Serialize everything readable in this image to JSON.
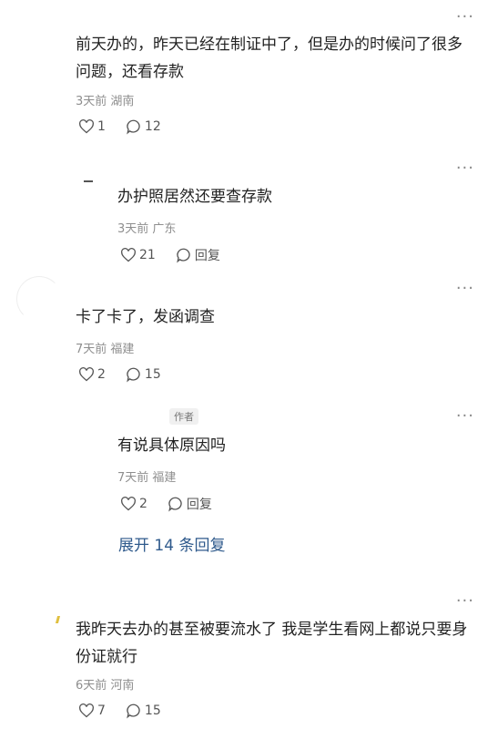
{
  "comments": [
    {
      "text": "前天办的，昨天已经在制证中了，但是办的时候问了很多问题，还看存款",
      "time": "3天前",
      "region": "湖南",
      "likes": "1",
      "replies": "12"
    },
    {
      "text": "办护照居然还要查存款",
      "time": "3天前",
      "region": "广东",
      "likes": "21",
      "reply_label": "回复"
    },
    {
      "text": "卡了卡了，发函调查",
      "time": "7天前",
      "region": "福建",
      "likes": "2",
      "replies": "15"
    },
    {
      "author_badge": "作者",
      "text": "有说具体原因吗",
      "time": "7天前",
      "region": "福建",
      "likes": "2",
      "reply_label": "回复"
    },
    {
      "text": "我昨天去办的甚至被要流水了 我是学生看网上都说只要身份证就行",
      "time": "6天前",
      "region": "河南",
      "likes": "7",
      "replies": "15"
    }
  ],
  "expand_replies": "展开 14 条回复",
  "more_glyph": "···",
  "colors": {
    "link": "#2f5a8c",
    "meta": "#8e8e8e",
    "text": "#222222"
  }
}
